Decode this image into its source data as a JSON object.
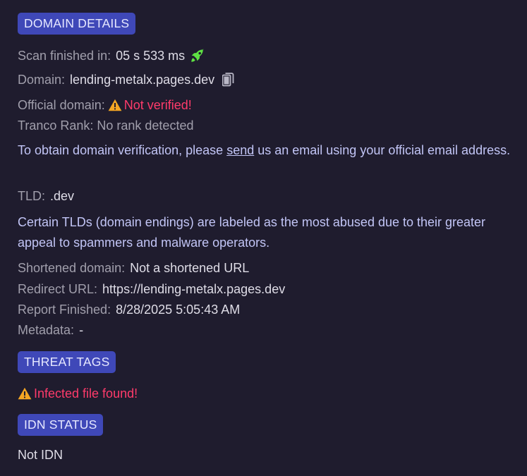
{
  "domain_details": {
    "heading": "DOMAIN DETAILS",
    "scan_label": "Scan finished in:",
    "scan_value": "05 s 533 ms",
    "domain_label": "Domain:",
    "domain_value": "lending-metalx.pages.dev",
    "official_label": "Official domain:",
    "official_value": "Not verified!",
    "tranco_text": "Tranco Rank: No rank detected",
    "verify_text_before": "To obtain domain verification, please ",
    "verify_link": "send",
    "verify_text_after": " us an email using your official email address.",
    "tld_label": "TLD:",
    "tld_value": ".dev",
    "tld_note": "Certain TLDs (domain endings) are labeled as the most abused due to their greater appeal to spammers and malware operators.",
    "shortened_label": "Shortened domain:",
    "shortened_value": "Not a shortened URL",
    "redirect_label": "Redirect URL:",
    "redirect_value": "https://lending-metalx.pages.dev",
    "report_label": "Report Finished:",
    "report_value": "8/28/2025 5:05:43 AM",
    "metadata_label": "Metadata:",
    "metadata_value": "-"
  },
  "threat_tags": {
    "heading": "THREAT TAGS",
    "tag": "Infected file found!"
  },
  "idn_status": {
    "heading": "IDN STATUS",
    "value": "Not IDN"
  },
  "colors": {
    "background": "#1f1c2e",
    "badge": "#3f48b8",
    "warning_text": "#ff3b6b",
    "warning_icon": "#f5a623",
    "rocket": "#5ee043",
    "info_text": "#c2c5f6"
  },
  "icons": {
    "rocket": "rocket-icon",
    "copy": "copy-icon",
    "warning": "warning-icon"
  }
}
